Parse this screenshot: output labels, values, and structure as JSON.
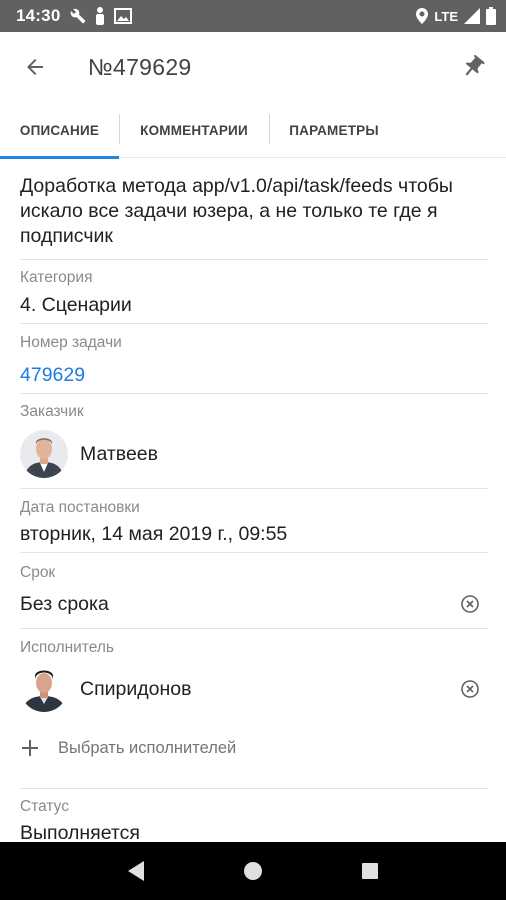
{
  "status_bar": {
    "time": "14:30",
    "network": "LTE",
    "icons": [
      "wrench-icon",
      "person-icon",
      "photo-icon",
      "location-icon",
      "signal-icon",
      "battery-icon"
    ]
  },
  "app_bar": {
    "title": "№479629",
    "back_icon": "arrow-back-icon",
    "pin_icon": "pin-icon"
  },
  "tabs": [
    {
      "label": "ОПИСАНИЕ",
      "active": true
    },
    {
      "label": "КОММЕНТАРИИ",
      "active": false
    },
    {
      "label": "ПАРАМЕТРЫ",
      "active": false
    }
  ],
  "task": {
    "description": "Доработка метода app/v1.0/api/task/feeds чтобы искало все задачи юзера, а не только те где я подписчик",
    "category_label": "Категория",
    "category_value": "4. Сценарии",
    "number_label": "Номер задачи",
    "number_value": "479629",
    "customer_label": "Заказчик",
    "customer_name": "Матвеев",
    "date_label": "Дата постановки",
    "date_value": "вторник, 14 мая 2019 г., 09:55",
    "deadline_label": "Срок",
    "deadline_value": "Без срока",
    "executor_label": "Исполнитель",
    "executor_name": "Спиридонов",
    "add_executors": "Выбрать исполнителей",
    "status_label": "Статус",
    "status_value": "Выполняется"
  },
  "colors": {
    "accent": "#1e88e5",
    "link": "#1e7be6",
    "status_bar": "#616161",
    "nav_bar": "#000000"
  },
  "nav": [
    "back-triangle-icon",
    "home-circle-icon",
    "recents-square-icon"
  ]
}
